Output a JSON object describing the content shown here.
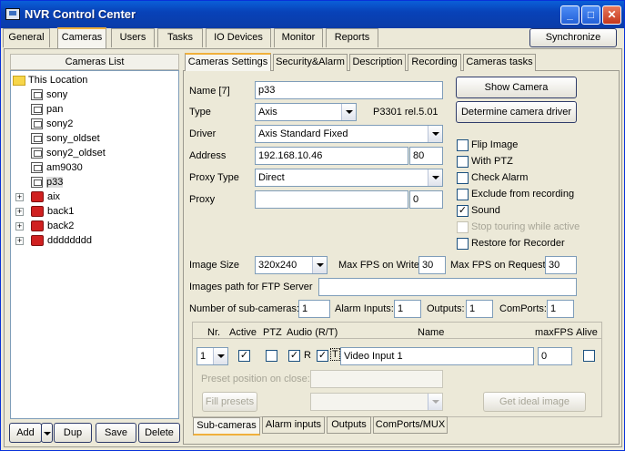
{
  "window": {
    "title": "NVR Control Center"
  },
  "title_buttons": {
    "minimize": "_",
    "maximize": "□",
    "close": "✕"
  },
  "main_tabs": [
    "General",
    "Cameras",
    "Users",
    "Tasks",
    "IO Devices",
    "Monitor",
    "Reports"
  ],
  "sync_button": "Synchronize",
  "cameras_list": {
    "header": "Cameras List",
    "root": "This Location",
    "cameras": [
      "sony",
      "pan",
      "sony2",
      "sony_oldset",
      "sony2_oldset",
      "am9030",
      "p33"
    ],
    "groups": [
      "aix",
      "back1",
      "back2",
      "dddddddd"
    ],
    "expand_symbol": "+"
  },
  "list_buttons": {
    "add": "Add",
    "dup": "Dup",
    "save": "Save",
    "delete": "Delete"
  },
  "settings_tabs": [
    "Cameras Settings",
    "Security&Alarm",
    "Description",
    "Recording",
    "Cameras tasks"
  ],
  "settings": {
    "name_label": "Name [7]",
    "name_value": "p33",
    "type_label": "Type",
    "type_value": "Axis",
    "model_text": "P3301 rel.5.01",
    "driver_label": "Driver",
    "driver_value": "Axis Standard Fixed",
    "address_label": "Address",
    "address_value": "192.168.10.46",
    "port_value": "80",
    "proxy_type_label": "Proxy Type",
    "proxy_type_value": "Direct",
    "proxy_label": "Proxy",
    "proxy_value": "",
    "proxy_port_value": "0",
    "show_camera": "Show Camera",
    "determine_driver": "Determine camera driver",
    "check_mark": "✓",
    "checkboxes": [
      {
        "label": "Flip Image",
        "checked": false,
        "disabled": false
      },
      {
        "label": "With PTZ",
        "checked": false,
        "disabled": false
      },
      {
        "label": "Check Alarm",
        "checked": false,
        "disabled": false
      },
      {
        "label": "Exclude from recording",
        "checked": false,
        "disabled": false
      },
      {
        "label": "Sound",
        "checked": true,
        "disabled": false
      },
      {
        "label": "Stop touring while active",
        "checked": false,
        "disabled": true
      },
      {
        "label": "Restore for Recorder",
        "checked": false,
        "disabled": false
      }
    ],
    "image_size_label": "Image Size",
    "image_size_value": "320x240",
    "max_fps_write_label": "Max FPS on Write",
    "max_fps_write_value": "30",
    "max_fps_request_label": "Max FPS on Request",
    "max_fps_request_value": "30",
    "ftp_label": "Images path for FTP Server",
    "ftp_value": "",
    "subcams_label": "Number of sub-cameras:",
    "subcams_value": "1",
    "alarm_inputs_label": "Alarm Inputs:",
    "alarm_inputs_value": "1",
    "outputs_label": "Outputs:",
    "outputs_value": "1",
    "comports_label": "ComPorts:",
    "comports_value": "1"
  },
  "subcam": {
    "headers": {
      "nr": "Nr.",
      "active": "Active",
      "ptz": "PTZ",
      "audio": "Audio (R/T)",
      "name": "Name",
      "maxfps": "maxFPS",
      "alive": "Alive"
    },
    "row": {
      "nr": "1",
      "active": true,
      "ptz": false,
      "audio_r": true,
      "r_letter": "R",
      "audio_t": true,
      "t_letter": "T",
      "name": "Video Input 1",
      "maxfps": "0",
      "alive": false
    },
    "preset_label": "Preset position on close:",
    "fill_presets": "Fill presets",
    "ideal_image": "Get ideal image",
    "tabs": [
      "Sub-cameras",
      "Alarm inputs",
      "Outputs",
      "ComPorts/MUX"
    ]
  }
}
